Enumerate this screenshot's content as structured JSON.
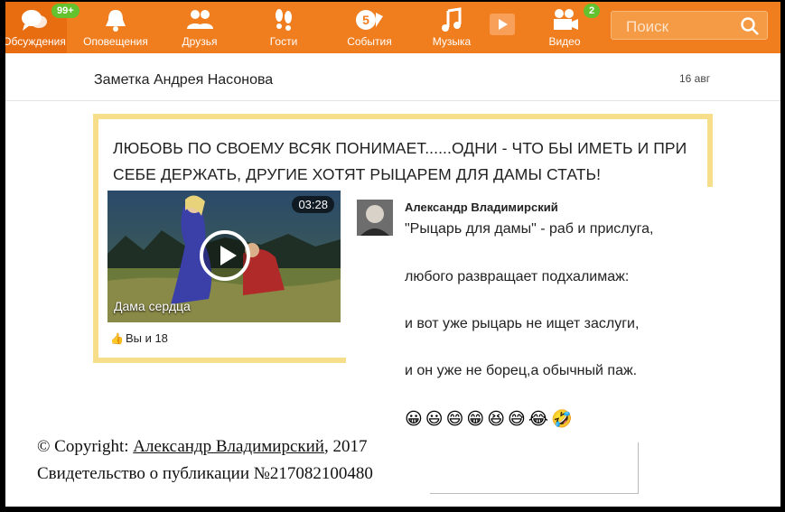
{
  "nav": {
    "items": [
      {
        "label": "Обсуждения",
        "icon": "discussions-icon",
        "badge": "99+"
      },
      {
        "label": "Оповещения",
        "icon": "bell-icon"
      },
      {
        "label": "Друзья",
        "icon": "friends-icon"
      },
      {
        "label": "Гости",
        "icon": "footprints-icon"
      },
      {
        "label": "События",
        "icon": "events-icon"
      },
      {
        "label": "Музыка",
        "icon": "music-icon"
      },
      {
        "label": "Видео",
        "icon": "video-camera-icon",
        "badge": "2"
      }
    ],
    "search_placeholder": "Поиск"
  },
  "note": {
    "title": "Заметка Андрея Насонова",
    "date": "16 авг",
    "headline": "ЛЮБОВЬ ПО СВОЕМУ ВСЯК ПОНИМАЕТ......ОДНИ - ЧТО БЫ ИМЕТЬ И ПРИ СЕБЕ ДЕРЖАТЬ, ДРУГИЕ ХОТЯТ РЫЦАРЕМ ДЛЯ ДАМЫ СТАТЬ!",
    "video": {
      "duration": "03:28",
      "title": "Дама сердца"
    },
    "likes": "Вы и 18"
  },
  "comment": {
    "author": "Александр Владимирский",
    "lines": [
      "\"Рыцарь для дамы\" - раб и прислуга,",
      "любого развращает подхалимаж:",
      "и вот уже рыцарь не ищет заслуги,",
      "и он уже не борец,а обычный паж."
    ],
    "emojis": "😀😃😄😁😆😅😂🤣"
  },
  "copyright": {
    "prefix": "© Copyright: ",
    "author_link": "Александр Владимирский",
    "suffix": ", 2017",
    "certificate": "Свидетельство о публикации №217082100480"
  },
  "colors": {
    "topbar": "#f07d1e",
    "badge": "#63c22d",
    "box_border": "#f6de8a"
  }
}
